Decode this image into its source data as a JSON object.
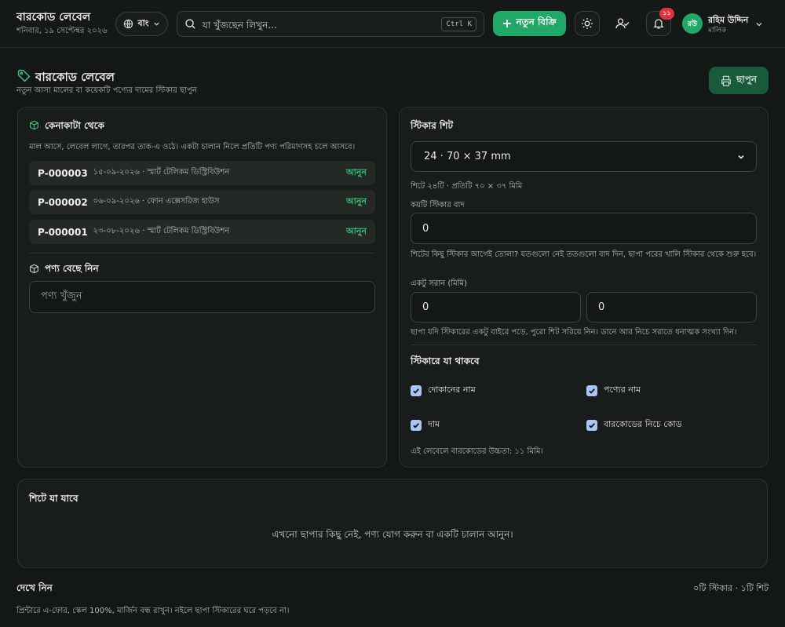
{
  "app": {
    "title": "বারকোড লেবেল",
    "date": "শনিবার, ১৯ সেপ্টেম্বর ২০২৬",
    "lang_label": "বাং",
    "search_placeholder": "যা খুঁজছেন লিখুন...",
    "search_shortcut": "Ctrl K",
    "new_sale_label": "নতুন বিক্রি",
    "notification_count": "১১",
    "user": {
      "initials": "রউ",
      "name": "রহিম উদ্দিন",
      "role": "মালিক"
    },
    "accent_color": "#1fa866"
  },
  "page": {
    "title": "বারকোড লেবেল",
    "subtitle": "নতুন আসা মালের বা কয়েকটি পণ্যের দামের স্টিকার ছাপুন",
    "print_label": "ছাপুন"
  },
  "purchase": {
    "title": "কেনাকাটা থেকে",
    "description": "মাল আসে, লেবেল লাগে, তারপর তাক-এ ওঠে। একটা চালান নিলে প্রতিটি পণ্য পরিমাণসহ চলে আসবে।",
    "challans": [
      {
        "id": "P-000003",
        "meta": "১৫-০৯-২০২৬ · স্মার্ট টেলিকম ডিস্ট্রিবিউশন",
        "action": "আনুন"
      },
      {
        "id": "P-000002",
        "meta": "০৬-০৯-২০২৬ · ফোন এক্সেসরিজ হাউস",
        "action": "আনুন"
      },
      {
        "id": "P-000001",
        "meta": "২৩-০৮-২০২৬ · স্মার্ট টেলিকম ডিস্ট্রিবিউশন",
        "action": "আনুন"
      }
    ],
    "pick_title": "পণ্য বেছে নিন",
    "product_placeholder": "পণ্য খুঁজুন"
  },
  "sheet": {
    "title": "স্টিকার শিট",
    "selected": "24 · 70 × 37 mm",
    "info": "শিটে ২৪টি · প্রতিটি ৭০ × ৩৭ মিমি",
    "skip_label": "কয়টি স্টিকার বাদ",
    "skip_value": "0",
    "skip_help": "শিটের কিছু স্টিকার আগেই তোলা? যতগুলো নেই ততগুলো বাদ দিন, ছাপা পরের খালি স্টিকার থেকে শুরু হবে।",
    "offset_label": "একটু সরান (মিমি)",
    "offset_x": "0",
    "offset_y": "0",
    "offset_help": "ছাপা যদি স্টিকারের একটু বাইরে পড়ে, পুরো শিট সরিয়ে নিন। ডানে আর নিচে সরাতে ধনাত্মক সংখ্যা দিন।",
    "contents_title": "স্টিকারে যা থাকবে",
    "options": [
      {
        "label": "দোকানের নাম",
        "checked": true
      },
      {
        "label": "পণ্যের নাম",
        "checked": true
      },
      {
        "label": "দাম",
        "checked": true
      },
      {
        "label": "বারকোডের নিচে কোড",
        "checked": true
      }
    ],
    "barcode_note": "এই লেবেলে বারকোডের উচ্চতা: ১১ মিমি।"
  },
  "queue": {
    "title": "শিটে যা যাবে",
    "empty": "এখনো ছাপার কিছু নেই, পণ্য যোগ করুন বা একটি চালান আনুন।"
  },
  "preview": {
    "title": "দেখে নিন",
    "count": "০টি স্টিকার · ১টি শিট",
    "note": "প্রিন্টারে এ-ফোর, স্কেল 100%, মার্জিন বন্ধ রাখুন। নইলে ছাপা স্টিকারের ঘরে পড়বে না।"
  }
}
